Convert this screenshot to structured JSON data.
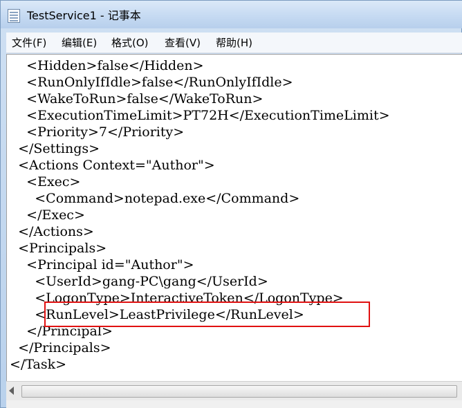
{
  "window": {
    "title": "TestService1 - 记事本"
  },
  "menu": {
    "items": [
      "文件(F)",
      "编辑(E)",
      "格式(O)",
      "查看(V)",
      "帮助(H)"
    ]
  },
  "editor": {
    "lines": [
      "    <Hidden>false</Hidden>",
      "    <RunOnlyIfIdle>false</RunOnlyIfIdle>",
      "    <WakeToRun>false</WakeToRun>",
      "    <ExecutionTimeLimit>PT72H</ExecutionTimeLimit>",
      "    <Priority>7</Priority>",
      "  </Settings>",
      "  <Actions Context=\"Author\">",
      "    <Exec>",
      "      <Command>notepad.exe</Command>",
      "    </Exec>",
      "  </Actions>",
      "  <Principals>",
      "    <Principal id=\"Author\">",
      "      <UserId>gang-PC\\gang</UserId>",
      "      <LogonType>InteractiveToken</LogonType>",
      "      <RunLevel>LeastPrivilege</RunLevel>",
      "    </Principal>",
      "  </Principals>",
      "</Task>"
    ],
    "highlight_color": "#e01010"
  },
  "icons": {
    "app": "notepad-icon",
    "scroll_left": "scroll-left-arrow-icon"
  }
}
